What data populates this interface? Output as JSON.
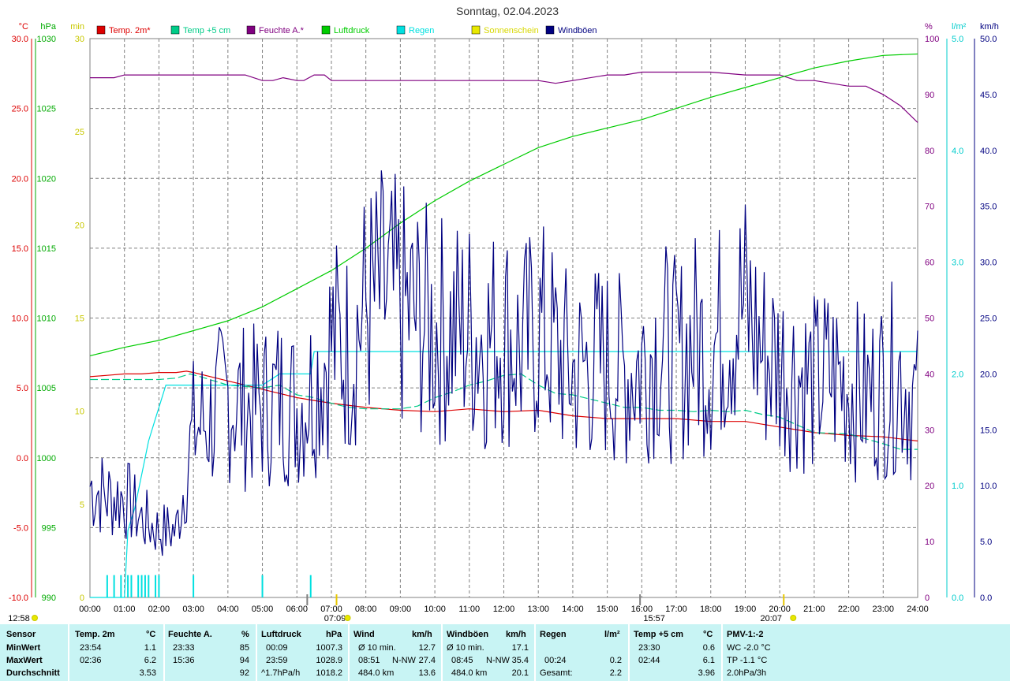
{
  "chart_data": {
    "type": "line",
    "title": "Sonntag, 02.04.2023",
    "x_ticks": [
      "00:00",
      "01:00",
      "02:00",
      "03:00",
      "04:00",
      "05:00",
      "06:00",
      "07:00",
      "08:00",
      "09:00",
      "10:00",
      "11:00",
      "12:00",
      "13:00",
      "14:00",
      "15:00",
      "16:00",
      "17:00",
      "18:00",
      "19:00",
      "20:00",
      "21:00",
      "22:00",
      "23:00",
      "24:00"
    ],
    "x_range_hours": [
      0,
      24
    ],
    "grid": true,
    "legend": [
      {
        "name": "Temp. 2m*",
        "color": "#dd0000"
      },
      {
        "name": "Temp +5 cm",
        "color": "#00cc88"
      },
      {
        "name": "Feuchte A.*",
        "color": "#800080"
      },
      {
        "name": "Luftdruck",
        "color": "#00cc00"
      },
      {
        "name": "Regen",
        "color": "#00e0e0"
      },
      {
        "name": "Sonnenschein",
        "color": "#e8e800"
      },
      {
        "name": "Windböen",
        "color": "#000080"
      }
    ],
    "axes": {
      "temp": {
        "unit": "°C",
        "range": [
          -10,
          30
        ],
        "ticks": [
          "-10.0",
          "-5.0",
          "0.0",
          "5.0",
          "10.0",
          "15.0",
          "20.0",
          "25.0",
          "30.0"
        ],
        "color": "#dd0000"
      },
      "pressure": {
        "unit": "hPa",
        "range": [
          990,
          1030
        ],
        "ticks": [
          "990",
          "995",
          "1000",
          "1005",
          "1010",
          "1015",
          "1020",
          "1025",
          "1030"
        ],
        "color": "#00aa00"
      },
      "sunshine": {
        "unit": "min",
        "range": [
          0,
          30
        ],
        "ticks": [
          "0",
          "5",
          "10",
          "15",
          "20",
          "25",
          "30"
        ],
        "color": "#c8c800"
      },
      "humidity": {
        "unit": "%",
        "range": [
          0,
          100
        ],
        "ticks": [
          "0",
          "10",
          "20",
          "30",
          "40",
          "50",
          "60",
          "70",
          "80",
          "90",
          "100"
        ],
        "color": "#800080"
      },
      "rain": {
        "unit": "l/m²",
        "range": [
          0,
          5
        ],
        "ticks": [
          "0.0",
          "1.0",
          "2.0",
          "3.0",
          "4.0",
          "5.0"
        ],
        "color": "#00cccc"
      },
      "wind": {
        "unit": "km/h",
        "range": [
          0,
          50
        ],
        "ticks": [
          "0.0",
          "5.0",
          "10.0",
          "15.0",
          "20.0",
          "25.0",
          "30.0",
          "35.0",
          "40.0",
          "45.0",
          "50.0"
        ],
        "color": "#000080"
      }
    },
    "series": [
      {
        "name": "Temp. 2m*",
        "axis": "temp",
        "color": "#dd0000",
        "x": [
          0,
          0.5,
          1,
          1.5,
          2,
          2.5,
          2.8,
          3,
          3.5,
          4,
          4.5,
          5,
          5.5,
          6,
          6.5,
          7,
          8,
          9,
          10,
          11,
          12,
          13,
          14,
          15,
          16,
          17,
          18,
          19,
          20,
          21,
          22,
          23,
          24
        ],
        "y": [
          5.8,
          5.9,
          6.0,
          6.0,
          6.1,
          6.1,
          6.2,
          6.1,
          5.8,
          5.5,
          5.2,
          4.9,
          4.6,
          4.3,
          4.1,
          3.9,
          3.6,
          3.4,
          3.3,
          3.5,
          3.3,
          3.4,
          3.0,
          2.8,
          2.8,
          2.8,
          2.6,
          2.6,
          2.2,
          1.8,
          1.6,
          1.5,
          1.2
        ]
      },
      {
        "name": "Temp +5 cm",
        "axis": "temp",
        "color": "#00cc88",
        "x": [
          0,
          1,
          2,
          2.5,
          2.9,
          3.2,
          4,
          5,
          5.5,
          6,
          6.5,
          7,
          7.5,
          8,
          9,
          9.5,
          10,
          10.5,
          11,
          11.5,
          12,
          12.5,
          13,
          13.5,
          14,
          14.5,
          15,
          15.5,
          16,
          16.5,
          17,
          17.5,
          18,
          18.5,
          19,
          19.5,
          20,
          21,
          22,
          23,
          23.5,
          24
        ],
        "y": [
          5.6,
          5.6,
          5.6,
          5.7,
          6.0,
          5.8,
          5.2,
          5.0,
          5.2,
          4.5,
          4.3,
          3.9,
          3.6,
          3.5,
          3.5,
          3.7,
          4.3,
          4.7,
          5.2,
          5.5,
          5.9,
          6.0,
          5.2,
          4.6,
          4.5,
          4.2,
          3.9,
          3.6,
          3.6,
          3.4,
          3.4,
          3.3,
          3.4,
          3.3,
          3.4,
          3.1,
          2.9,
          1.8,
          1.7,
          1.0,
          0.6,
          0.6
        ]
      },
      {
        "name": "Feuchte A.*",
        "axis": "humidity",
        "color": "#800080",
        "x": [
          0,
          0.3,
          0.7,
          1,
          2,
          3,
          4,
          4.5,
          5,
          5.3,
          5.6,
          6,
          6.2,
          6.5,
          6.8,
          7,
          8,
          9,
          10,
          11,
          12,
          13,
          13.5,
          14,
          15,
          15.5,
          16,
          17,
          18,
          19,
          20,
          20.5,
          21,
          22,
          22.5,
          23,
          23.5,
          24
        ],
        "y": [
          93,
          93,
          93,
          93.5,
          93.5,
          93.5,
          93.5,
          93.5,
          92.5,
          92.5,
          93,
          92.5,
          92.5,
          93.5,
          93.5,
          92.5,
          92.5,
          92.5,
          92.5,
          92.5,
          92.5,
          92.5,
          92,
          92.5,
          93.5,
          93.5,
          94,
          94,
          94,
          93.5,
          93.5,
          92.5,
          92.5,
          91.5,
          91.5,
          90,
          88,
          85
        ]
      },
      {
        "name": "Luftdruck",
        "axis": "pressure",
        "color": "#00cc00",
        "x": [
          0,
          1,
          2,
          3,
          4,
          5,
          6,
          7,
          8,
          9,
          10,
          11,
          12,
          13,
          14,
          15,
          16,
          17,
          18,
          19,
          20,
          21,
          22,
          23,
          24
        ],
        "y": [
          1007.3,
          1007.9,
          1008.4,
          1009.1,
          1009.8,
          1010.8,
          1012.1,
          1013.4,
          1015.0,
          1016.8,
          1018.4,
          1019.8,
          1021.0,
          1022.2,
          1023.0,
          1023.6,
          1024.2,
          1025.0,
          1025.8,
          1026.5,
          1027.2,
          1027.9,
          1028.4,
          1028.8,
          1028.9
        ]
      },
      {
        "name": "Regen",
        "axis": "rain",
        "color": "#00e0e0",
        "x": [
          0,
          1,
          1.1,
          1.3,
          1.5,
          1.7,
          1.9,
          2.05,
          2.2,
          3,
          3.5,
          4,
          4.5,
          5,
          5.5,
          6,
          6.2,
          6.4,
          6.5,
          7,
          8,
          9,
          10,
          11,
          12,
          13,
          14,
          15,
          16,
          17,
          18,
          19,
          20,
          21,
          22,
          23,
          24
        ],
        "y": [
          0,
          0,
          0.6,
          0.8,
          1.1,
          1.4,
          1.6,
          1.75,
          1.9,
          1.9,
          1.9,
          1.9,
          1.9,
          1.9,
          2.0,
          2.0,
          2.0,
          2.0,
          2.2,
          2.2,
          2.2,
          2.2,
          2.2,
          2.2,
          2.2,
          2.2,
          2.2,
          2.2,
          2.2,
          2.2,
          2.2,
          2.2,
          2.2,
          2.2,
          2.2,
          2.2,
          2.2
        ]
      },
      {
        "name": "Sonnenschein",
        "axis": "sunshine",
        "color": "#e8e800",
        "x": [],
        "y": []
      },
      {
        "name": "Windböen",
        "axis": "wind",
        "color": "#000080",
        "x": [
          0,
          0.5,
          1,
          1.5,
          2,
          2.5,
          3,
          3.5,
          4,
          4.5,
          5,
          5.5,
          6,
          6.5,
          7,
          7.5,
          8,
          8.5,
          9,
          9.5,
          10,
          10.5,
          11,
          11.5,
          12,
          12.5,
          13,
          13.5,
          14,
          14.5,
          15,
          15.5,
          16,
          16.5,
          17,
          17.5,
          18,
          18.5,
          19,
          19.5,
          20,
          20.5,
          21,
          21.5,
          22,
          22.5,
          23,
          23.5,
          24
        ],
        "y": [
          10,
          9,
          9,
          7,
          6,
          6,
          15,
          16,
          18,
          17,
          17,
          18,
          17,
          19,
          23,
          22,
          26,
          27,
          26,
          25,
          24,
          24,
          24,
          23,
          24,
          22,
          24,
          22,
          20,
          21,
          21,
          20,
          21,
          23,
          21,
          23,
          22,
          25,
          26,
          22,
          21,
          20,
          19,
          20,
          19,
          18,
          19,
          20,
          17
        ]
      }
    ],
    "rain_bars": {
      "x": [
        0.5,
        0.7,
        0.9,
        1.1,
        1.2,
        1.4,
        1.5,
        1.6,
        1.7,
        1.9,
        2.0,
        3.0,
        5.0,
        6.4
      ],
      "height_mm": [
        0.2,
        0.2,
        0.2,
        0.2,
        0.2,
        0.2,
        0.2,
        0.2,
        0.2,
        0.2,
        0.2,
        0.2,
        0.2,
        0.2
      ]
    },
    "annotations": {
      "sunrise": "07:09",
      "sunset": "20:07",
      "moonrise": "12:58",
      "transit": "15:57"
    }
  },
  "stats": {
    "sensor_label": "Sensor",
    "row_labels": [
      "MinWert",
      "MaxWert",
      "Durchschnitt"
    ],
    "temp": {
      "header": "Temp. 2m",
      "unit": "°C",
      "min_time": "23:54",
      "min": "1.1",
      "max_time": "02:36",
      "max": "6.2",
      "avg": "3.53"
    },
    "humidity": {
      "header": "Feuchte A.",
      "unit": "%",
      "min_time": "23:33",
      "min": "85",
      "max_time": "15:36",
      "max": "94",
      "avg": "92"
    },
    "pressure": {
      "header": "Luftdruck",
      "unit": "hPa",
      "min_time": "00:09",
      "min": "1007.3",
      "max_time": "23:59",
      "max": "1028.9",
      "trend": "^1.7hPa/h",
      "avg": "1018.2"
    },
    "wind": {
      "header": "Wind",
      "unit": "km/h",
      "avg_label": "Ø 10 min.",
      "avg10": "12.7",
      "max_time": "08:51",
      "max_dir": "N-NW",
      "max": "27.4",
      "run": "484.0 km",
      "avg": "13.6"
    },
    "gusts": {
      "header": "Windböen",
      "unit": "km/h",
      "avg_label": "Ø 10 min.",
      "avg10": "17.1",
      "max_time": "08:45",
      "max_dir": "N-NW",
      "max": "35.4",
      "run": "484.0 km",
      "avg": "20.1"
    },
    "rain": {
      "header": "Regen",
      "unit": "l/m²",
      "max_time": "00:24",
      "max": "0.2",
      "total_label": "Gesamt:",
      "total": "2.2"
    },
    "temp5": {
      "header": "Temp +5 cm",
      "unit": "°C",
      "min_time": "23:30",
      "min": "0.6",
      "max_time": "02:44",
      "max": "6.1",
      "avg": "3.96"
    },
    "pmv": {
      "header": "PMV-1:-2",
      "wc": "WC -2.0 °C",
      "tp": "TP -1.1 °C",
      "tendency": "2.0hPa/3h"
    }
  }
}
